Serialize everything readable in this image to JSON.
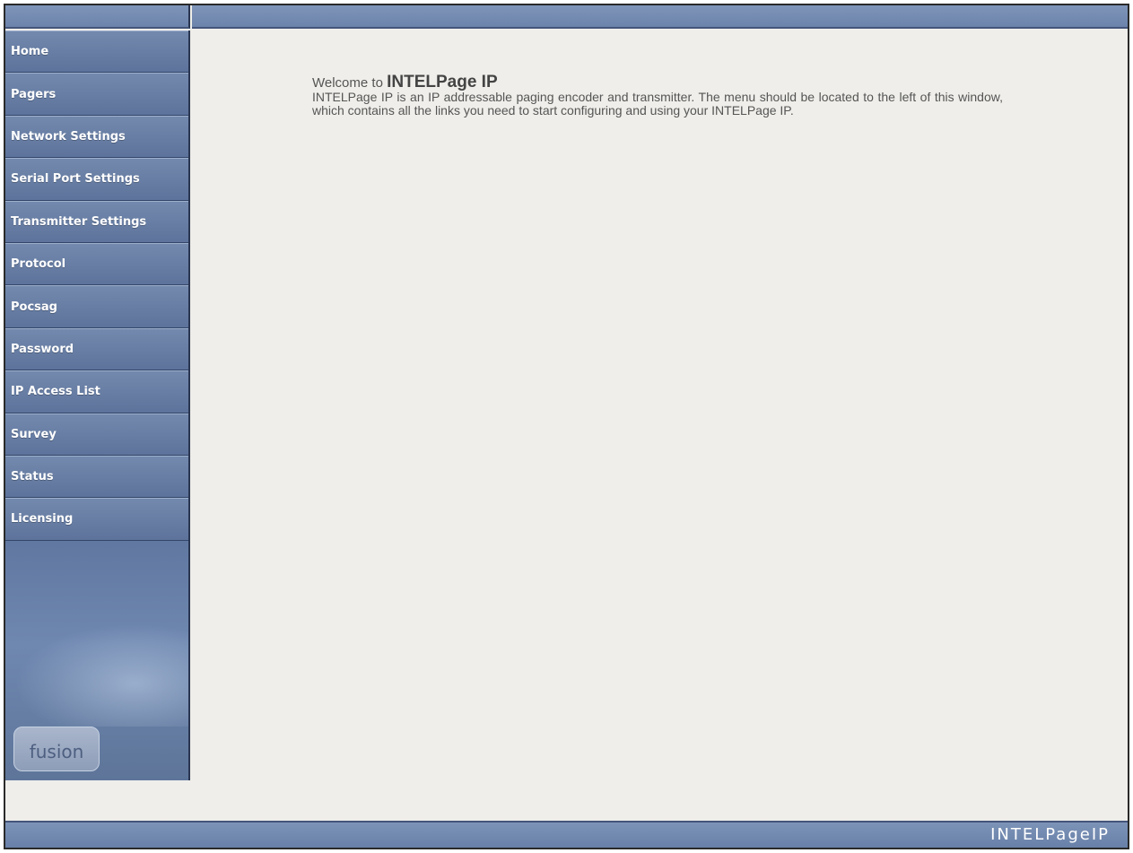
{
  "sidebar": {
    "items": [
      {
        "label": "Home"
      },
      {
        "label": "Pagers"
      },
      {
        "label": "Network Settings"
      },
      {
        "label": "Serial Port Settings"
      },
      {
        "label": "Transmitter Settings"
      },
      {
        "label": "Protocol"
      },
      {
        "label": "Pocsag"
      },
      {
        "label": "Password"
      },
      {
        "label": "IP Access List"
      },
      {
        "label": "Survey"
      },
      {
        "label": "Status"
      },
      {
        "label": "Licensing"
      }
    ],
    "logo_text": "fusion"
  },
  "main": {
    "welcome_prefix": "Welcome to ",
    "welcome_product": "INTELPage IP",
    "intro": "INTELPage IP is an IP addressable paging encoder and transmitter. The menu should be located to the left of this window, which contains all the links you need to start configuring and using your INTELPage IP."
  },
  "footer": {
    "brand": "INTELPageIP"
  },
  "colors": {
    "nav_bar": "#6c83ab",
    "sidebar": "#5b729a",
    "content_bg": "#efeeea",
    "text": "#555555"
  }
}
